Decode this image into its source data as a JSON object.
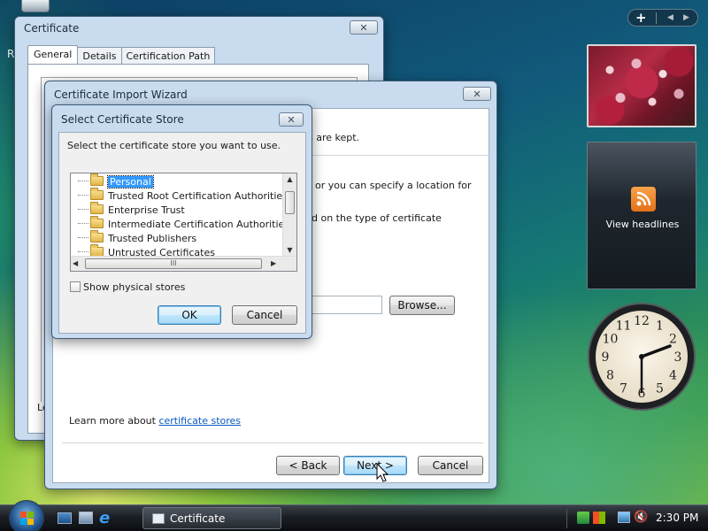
{
  "certificate_window": {
    "title": "Certificate",
    "close_label": "✕",
    "tabs": [
      "General",
      "Details",
      "Certification Path"
    ],
    "bottom_fragment": "Le"
  },
  "import_wizard": {
    "title": "Certificate Import Wizard",
    "close_label": "✕",
    "text_fragment_1": "s are kept.",
    "text_fragment_2": "or you can specify a location for",
    "text_fragment_3": "d on the type of certificate",
    "browse_button": "Browse...",
    "learn_more_prefix": "Learn more about ",
    "learn_more_link": "certificate stores",
    "back_button": "< Back",
    "next_button": "Next >",
    "cancel_button": "Cancel"
  },
  "store_dialog": {
    "title": "Select Certificate Store",
    "close_label": "✕",
    "prompt": "Select the certificate store you want to use.",
    "stores": [
      "Personal",
      "Trusted Root Certification Authorities",
      "Enterprise Trust",
      "Intermediate Certification Authorities",
      "Trusted Publishers",
      "Untrusted Certificates"
    ],
    "selected_index": 0,
    "scroll_grip": "III",
    "show_physical_label": "Show physical stores",
    "show_physical_checked": false,
    "ok_button": "OK",
    "cancel_button": "Cancel"
  },
  "sidebar": {
    "add_label": "+",
    "feed_label": "View headlines",
    "clock_numbers": [
      "12",
      "1",
      "2",
      "3",
      "4",
      "5",
      "6",
      "7",
      "8",
      "9",
      "10",
      "11"
    ]
  },
  "desktop": {
    "left_edge_fragment": "R"
  },
  "taskbar": {
    "task_label": "Certificate",
    "time": "2:30 PM"
  },
  "colors": {
    "selection": "#3399ff",
    "link": "#0a58c2",
    "taskbar": "#1b1f24"
  }
}
